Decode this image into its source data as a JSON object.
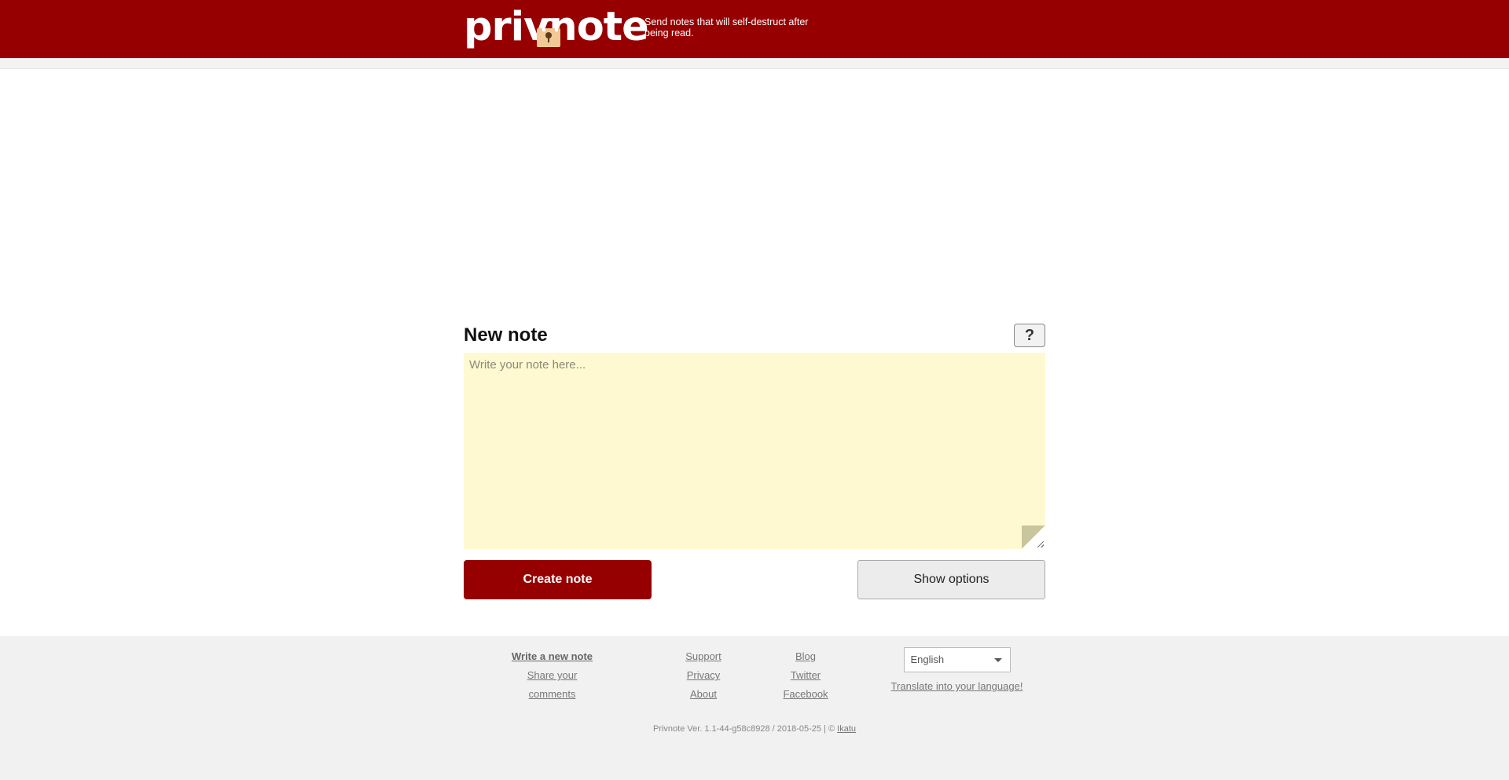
{
  "header": {
    "logo_text_left": "privn",
    "logo_text_right": "ote",
    "tagline": "Send notes that will self-destruct after being read.",
    "background_color": "#960000"
  },
  "main": {
    "title": "New note",
    "help_label": "?",
    "note_placeholder": "Write your note here...",
    "note_value": "",
    "note_background": "#fef9d1",
    "create_button_label": "Create note",
    "options_button_label": "Show options"
  },
  "footer": {
    "col1": [
      "Write a new note",
      "Share your comments"
    ],
    "col2": [
      "Support",
      "Privacy",
      "About"
    ],
    "col3": [
      "Blog",
      "Twitter",
      "Facebook"
    ],
    "language": {
      "selected": "English",
      "translate_link": "Translate into your language!"
    },
    "version_text": "Privnote Ver. 1.1-44-g58c8928 / 2018-05-25 | © ",
    "version_link": "Ikatu"
  },
  "icons": {
    "logo_lock": "lock-icon",
    "language_dropdown": "chevron-down-icon"
  }
}
